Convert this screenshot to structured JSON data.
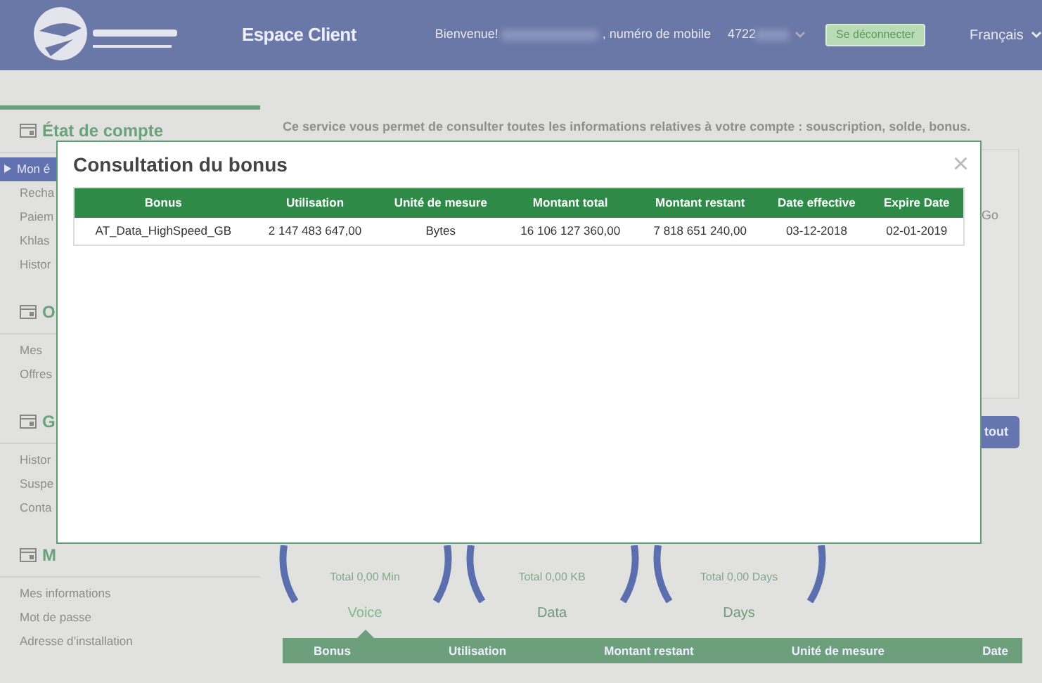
{
  "header": {
    "title": "Espace Client",
    "welcome": "Bienvenue!",
    "mobile_label": ", numéro de mobile",
    "mobile": "4722",
    "logout": "Se déconnecter",
    "language": "Français"
  },
  "sidebar": {
    "sections": [
      {
        "title": "État de compte",
        "items": [
          {
            "label": "Mon é",
            "selected": true
          },
          {
            "label": "Recha",
            "selected": false
          },
          {
            "label": "Paiem",
            "selected": false
          },
          {
            "label": "Khlas",
            "selected": false
          },
          {
            "label": "Histor",
            "selected": false
          }
        ]
      },
      {
        "title": "O",
        "items": [
          {
            "label": "Mes",
            "selected": false
          },
          {
            "label": "Offres",
            "selected": false
          }
        ]
      },
      {
        "title": "G",
        "items": [
          {
            "label": "Histor",
            "selected": false
          },
          {
            "label": "Suspe",
            "selected": false
          },
          {
            "label": "Conta",
            "selected": false
          }
        ]
      },
      {
        "title": "M",
        "items": [
          {
            "label": "Mes informations",
            "selected": false
          },
          {
            "label": "Mot de passe",
            "selected": false
          },
          {
            "label": "Adresse d’installation",
            "selected": false
          }
        ]
      }
    ]
  },
  "intro": "Ce service vous permet de consulter toutes les informations relatives à votre compte : souscription, solde, bonus.",
  "panel_text": "Go",
  "panel_button": "tout",
  "gauges": [
    {
      "total": "Total 0,00 Min",
      "label": "Voice",
      "selected": true
    },
    {
      "total": "Total 0,00 KB",
      "label": "Data",
      "selected": false
    },
    {
      "total": "Total 0,00 Days",
      "label": "Days",
      "selected": false
    }
  ],
  "bonus_table": {
    "columns": [
      "Bonus",
      "Utilisation",
      "Montant restant",
      "Unité de mesure",
      "Date"
    ]
  },
  "modal": {
    "title": "Consultation du bonus",
    "close": "×",
    "columns": [
      "Bonus",
      "Utilisation",
      "Unité de mesure",
      "Montant total",
      "Montant restant",
      "Date effective",
      "Expire Date"
    ],
    "rows": [
      [
        "AT_Data_HighSpeed_GB",
        "2 147 483 647,00",
        "Bytes",
        "16 106 127 360,00",
        "7 818 651 240,00",
        "03-12-2018",
        "02-01-2019"
      ]
    ]
  }
}
